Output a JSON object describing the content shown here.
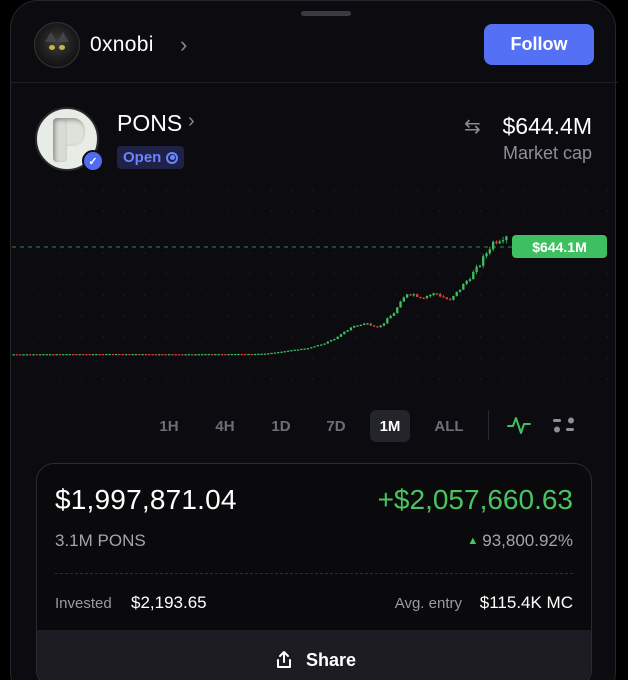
{
  "profile": {
    "username": "0xnobi",
    "follow_label": "Follow"
  },
  "token": {
    "ticker": "PONS",
    "status_badge": "Open",
    "market_cap": "$644.4M",
    "market_cap_label": "Market cap"
  },
  "chart_data": {
    "type": "line",
    "title": "",
    "current_price_label": "$644.1M",
    "series": [
      {
        "values": [
          4,
          4,
          4.5,
          4.5,
          5,
          5,
          5,
          5.5,
          5,
          5,
          4.5,
          4.5,
          4,
          4.5,
          5,
          5,
          5.5,
          5.5,
          8,
          18,
          28,
          38,
          60,
          95,
          150,
          170,
          150,
          225,
          335,
          310,
          330,
          290,
          380,
          470,
          600,
          644
        ]
      }
    ],
    "colors": {
      "up": "#3fc060",
      "down": "#e0433a",
      "reference_line": "#3fc060"
    }
  },
  "timeframes": {
    "options": [
      "1H",
      "4H",
      "1D",
      "7D",
      "1M",
      "ALL"
    ],
    "selected": "1M"
  },
  "position": {
    "value": "$1,997,871.04",
    "token_amount": "3.1M PONS",
    "pnl": "+$2,057,660.63",
    "pnl_percent": "93,800.92%",
    "invested_label": "Invested",
    "invested_value": "$2,193.65",
    "avg_entry_label": "Avg. entry",
    "avg_entry_value": "$115.4K MC"
  },
  "share": {
    "label": "Share"
  },
  "colors": {
    "accent": "#5470f5",
    "positive": "#49c45f",
    "background": "#0c0c10"
  }
}
